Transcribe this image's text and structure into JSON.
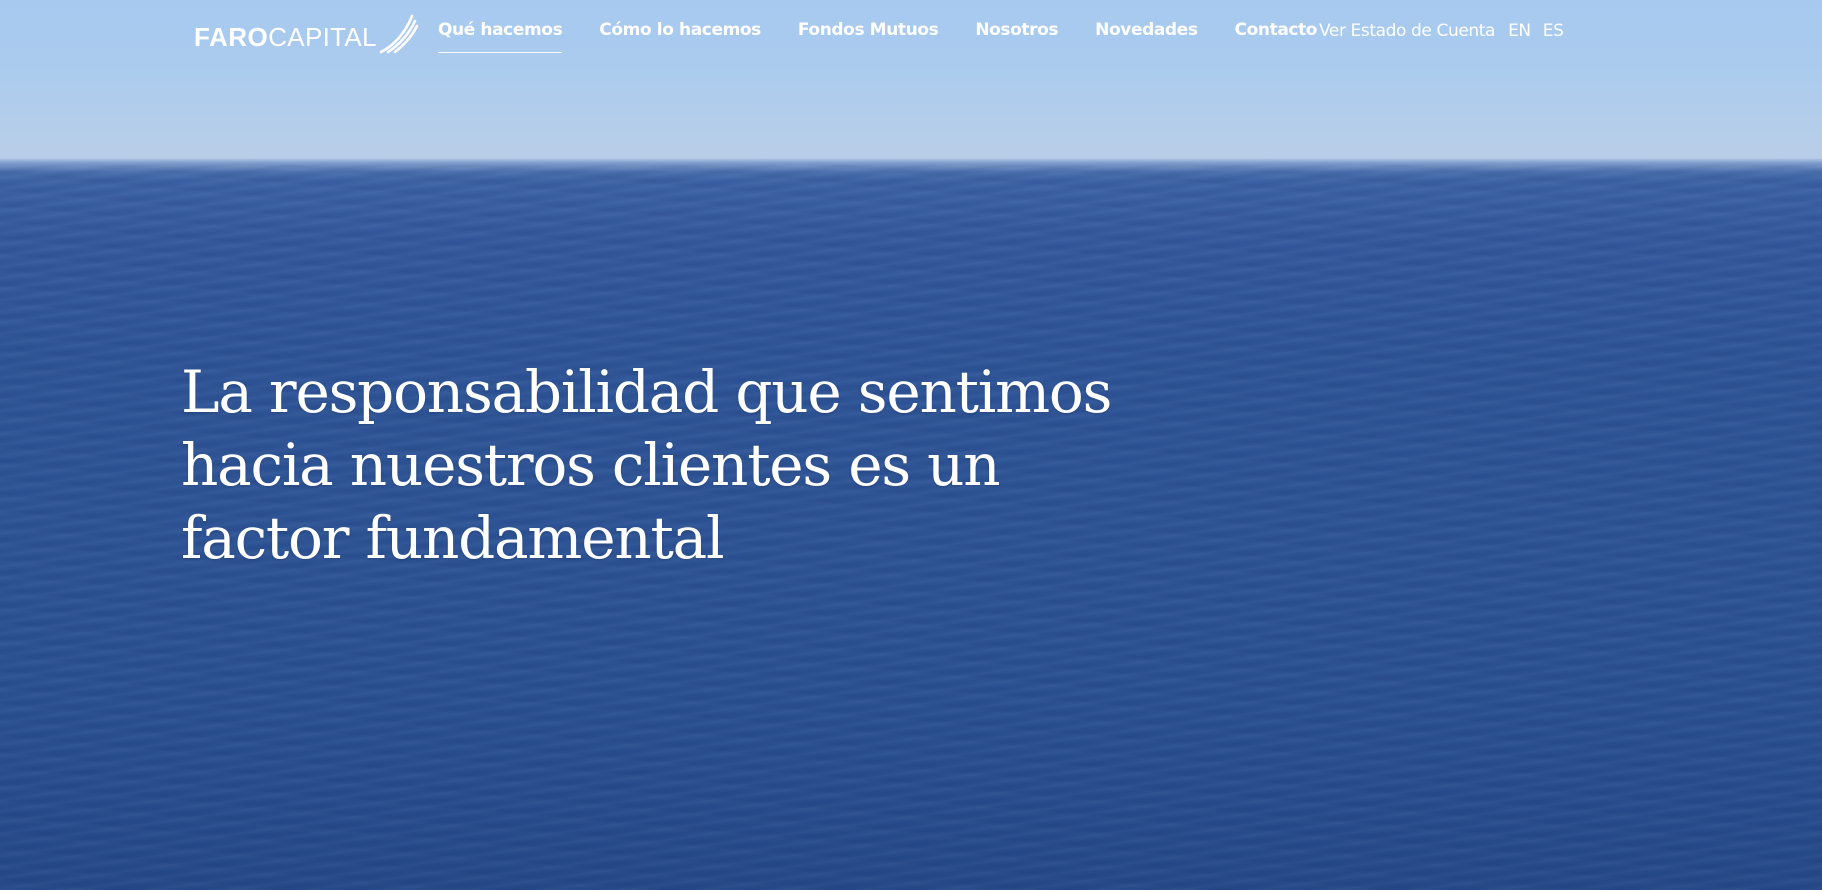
{
  "brand": {
    "name_bold": "FARO",
    "name_regular": "CAPITAL",
    "logo_icon": "lighthouse-beam-icon"
  },
  "nav": {
    "items": [
      {
        "label": "Qué hacemos",
        "active": true
      },
      {
        "label": "Cómo lo hacemos",
        "active": false
      },
      {
        "label": "Fondos Mutuos",
        "active": false
      },
      {
        "label": "Nosotros",
        "active": false
      },
      {
        "label": "Novedades",
        "active": false
      },
      {
        "label": "Contacto",
        "active": false
      }
    ]
  },
  "utility": {
    "account_label": "Ver Estado de Cuenta",
    "languages": [
      "EN",
      "ES"
    ]
  },
  "hero": {
    "headline_lines": [
      "La responsabilidad que sentimos",
      "hacia nuestros clientes es un",
      "factor fundamental"
    ]
  },
  "colors": {
    "text": "#ffffff",
    "sky": "#a7c9f0",
    "ocean": "#2e5495"
  }
}
